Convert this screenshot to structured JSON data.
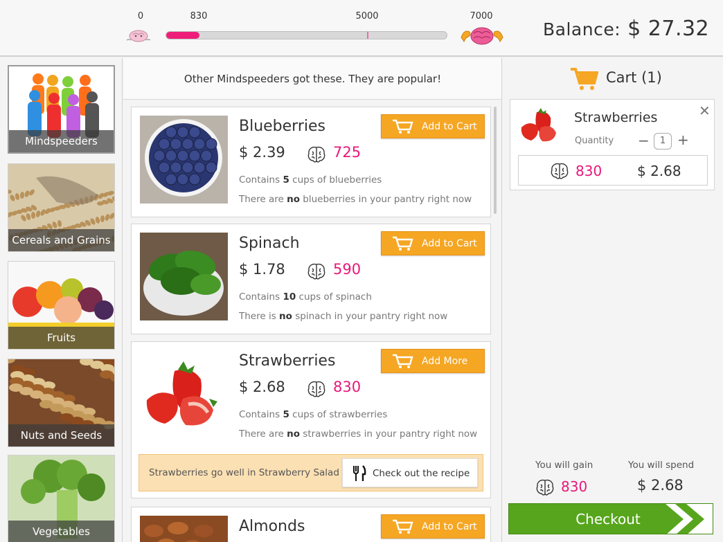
{
  "progress": {
    "labels": [
      "0",
      "830",
      "5000",
      "7000"
    ],
    "current": 830,
    "max": 7000,
    "start_icon": "small-brain-icon",
    "end_icon": "muscular-brain-icon",
    "accent": "#ee1d79"
  },
  "balance": {
    "label": "Balance:",
    "amount": "$ 27.32"
  },
  "categories": [
    {
      "label": "Mindspeeders",
      "active": true
    },
    {
      "label": "Cereals and Grains"
    },
    {
      "label": "Fruits"
    },
    {
      "label": "Nuts and Seeds"
    },
    {
      "label": "Vegetables"
    }
  ],
  "list": {
    "header": "Other Mindspeeders got these. They are popular!",
    "items": [
      {
        "name": "Blueberries",
        "price": "$ 2.39",
        "points": "725",
        "button": "Add to Cart",
        "contains_pre": "Contains",
        "contains_qty": "5",
        "contains_post": "cups of blueberries",
        "pantry_pre": "There are",
        "pantry_bold": "no",
        "pantry_post": "blueberries in your pantry right now"
      },
      {
        "name": "Spinach",
        "price": "$ 1.78",
        "points": "590",
        "button": "Add to Cart",
        "contains_pre": "Contains",
        "contains_qty": "10",
        "contains_post": "cups of spinach",
        "pantry_pre": "There is",
        "pantry_bold": "no",
        "pantry_post": "spinach in your pantry right now"
      },
      {
        "name": "Strawberries",
        "price": "$ 2.68",
        "points": "830",
        "button": "Add More",
        "contains_pre": "Contains",
        "contains_qty": "5",
        "contains_post": "cups of strawberries",
        "pantry_pre": "There are",
        "pantry_bold": "no",
        "pantry_post": "strawberries in your pantry right now",
        "recipe_text": "Strawberries go well in Strawberry Salad",
        "recipe_button": "Check out the recipe"
      },
      {
        "name": "Almonds",
        "button": "Add to Cart"
      }
    ]
  },
  "cart": {
    "title": "Cart (1)",
    "item": {
      "name": "Strawberries",
      "quantity_label": "Quantity",
      "quantity": "1",
      "minus": "−",
      "plus": "+",
      "close": "✕",
      "points": "830",
      "price": "$  2.68"
    },
    "gain_label": "You will gain",
    "spend_label": "You will spend",
    "gain_value": "830",
    "spend_value": "$ 2.68",
    "checkout": "Checkout"
  },
  "colors": {
    "orange": "#f5a623",
    "green": "#57a51d",
    "pink": "#e8177a"
  }
}
